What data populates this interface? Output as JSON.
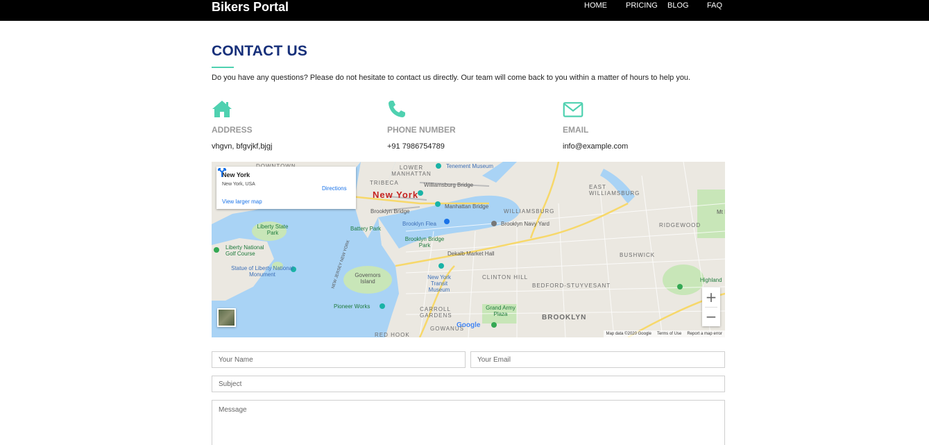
{
  "nav": {
    "brand": "Bikers Portal",
    "links": [
      {
        "label": "HOME"
      },
      {
        "label": "PRICING"
      },
      {
        "label": "BLOG"
      },
      {
        "label": "FAQ"
      }
    ]
  },
  "contact": {
    "title": "CONTACT US",
    "intro": "Do you have any questions? Please do not hesitate to contact us directly. Our team will come back to you within a matter of hours to help you.",
    "address": {
      "label": "ADDRESS",
      "value": "vhgvn, bfgvjkf,bjgj",
      "icon": "home-icon"
    },
    "phone": {
      "label": "PHONE NUMBER",
      "value": "+91 7986754789",
      "icon": "phone-icon"
    },
    "email": {
      "label": "EMAIL",
      "value": "info@example.com",
      "icon": "envelope-icon"
    },
    "accent_color": "#4fd1b0",
    "title_color": "#17307a"
  },
  "map": {
    "card": {
      "title": "New York",
      "subtitle": "New York, USA",
      "directions": "Directions",
      "larger_map": "View larger map"
    },
    "labels": {
      "new_york": "New York",
      "downtown": "DOWNTOWN",
      "tribeca": "TRIBECA",
      "lower_manhattan": "LOWER MANHATTAN",
      "tenement": "Tenement Museum",
      "williamsburg_bridge": "Williamsburg Bridge",
      "east_williamsburg": "EAST WILLIAMSBURG",
      "brooklyn_bridge": "Brooklyn Bridge",
      "manhattan_bridge": "Manhattan Bridge",
      "williamsburg": "WILLIAMSBURG",
      "liberty_state_park": "Liberty State Park",
      "battery_park": "Battery Park",
      "brooklyn_flea": "Brooklyn Flea",
      "brooklyn_navy_yard": "Brooklyn Navy Yard",
      "ridgewood": "RIDGEWOOD",
      "liberty_national": "Liberty National Golf Course",
      "brooklyn_bridge_park": "Brooklyn Bridge Park",
      "dekalb": "Dekalb Market Hall",
      "bushwick": "BUSHWICK",
      "statue_of_liberty": "Statue of Liberty National Monument",
      "governors_island": "Governors Island",
      "new_york_transit": "New York Transit Museum",
      "clinton_hill": "CLINTON HILL",
      "bedford_stuyvesant": "BEDFORD-STUYVESANT",
      "highland": "Highland",
      "pioneer_works": "Pioneer Works",
      "carroll_gardens": "CARROLL GARDENS",
      "grand_army_plaza": "Grand Army Plaza",
      "brooklyn": "BROOKLYN",
      "red_hook": "RED HOOK",
      "gowanus": "GOWANUS",
      "new_jersey": "NEW JERSEY NEW YORK",
      "mt_le": "Mt Le"
    },
    "zoom_in": "+",
    "zoom_out": "−",
    "google": "Google",
    "footer": {
      "data": "Map data ©2020 Google",
      "terms": "Terms of Use",
      "report": "Report a map error"
    },
    "water_color": "#a9d3f5",
    "land_color": "#ebe8e1",
    "park_color": "#c8e6b8"
  },
  "form": {
    "name_placeholder": "Your Name",
    "email_placeholder": "Your Email",
    "subject_placeholder": "Subject",
    "message_placeholder": "Message"
  }
}
